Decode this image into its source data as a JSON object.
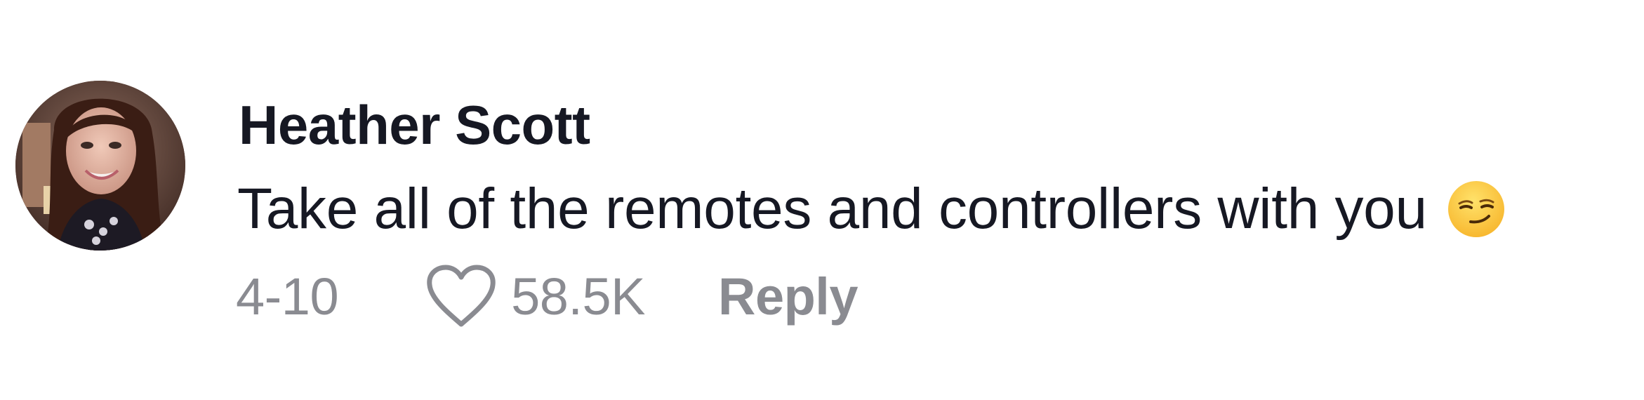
{
  "comment": {
    "author": "Heather Scott",
    "text": "Take all of the remotes and controllers with you",
    "emoji": "smirking-face",
    "date": "4-10",
    "likes": "58.5K",
    "reply_label": "Reply"
  },
  "colors": {
    "primary_text": "#161823",
    "secondary_text": "#8a8b91",
    "background": "#ffffff"
  },
  "icons": {
    "like": "heart-outline-icon",
    "avatar": "profile-photo"
  }
}
